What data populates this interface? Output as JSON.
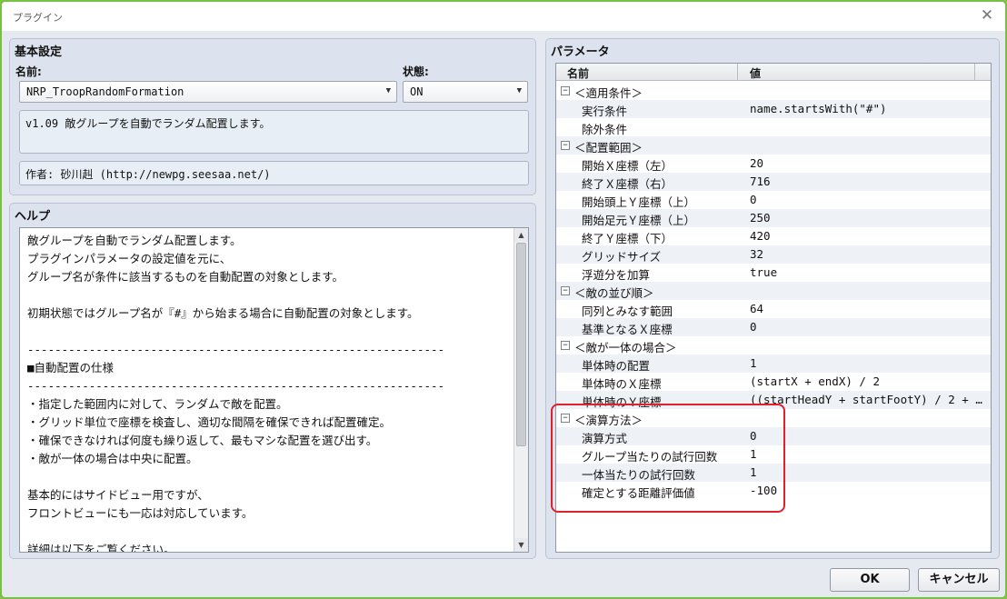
{
  "window": {
    "title": "プラグイン",
    "close_glyph": "✕"
  },
  "basic": {
    "group_title": "基本設定",
    "name_label": "名前:",
    "name_value": "NRP_TroopRandomFormation",
    "status_label": "状態:",
    "status_value": "ON",
    "description": "v1.09 敵グループを自動でランダム配置します。",
    "author": "作者: 砂川赳 (http://newpg.seesaa.net/)"
  },
  "help": {
    "group_title": "ヘルプ",
    "text": "敵グループを自動でランダム配置します。\nプラグインパラメータの設定値を元に、\nグループ名が条件に該当するものを自動配置の対象とします。\n\n初期状態ではグループ名が『#』から始まる場合に自動配置の対象とします。\n\n-------------------------------------------------------------\n■自動配置の仕様\n-------------------------------------------------------------\n・指定した範囲内に対して、ランダムで敵を配置。\n・グリッド単位で座標を検査し、適切な間隔を確保できれば配置確定。\n・確保できなければ何度も繰り返して、最もマシな配置を選び出す。\n・敵が一体の場合は中央に配置。\n\n基本的にはサイドビュー用ですが、\nフロントビューにも一応は対応しています。\n\n詳細は以下をご覧ください。"
  },
  "params": {
    "group_title": "パラメータ",
    "col_name": "名前",
    "col_value": "値",
    "rows": [
      {
        "name": "＜適用条件＞",
        "value": "",
        "group": true
      },
      {
        "name": "実行条件",
        "value": "name.startsWith(\"#\")",
        "group": false
      },
      {
        "name": "除外条件",
        "value": "",
        "group": false
      },
      {
        "name": "＜配置範囲＞",
        "value": "",
        "group": true
      },
      {
        "name": "開始Ｘ座標（左）",
        "value": "20",
        "group": false
      },
      {
        "name": "終了Ｘ座標（右）",
        "value": "716",
        "group": false
      },
      {
        "name": "開始頭上Ｙ座標（上）",
        "value": "0",
        "group": false
      },
      {
        "name": "開始足元Ｙ座標（上）",
        "value": "250",
        "group": false
      },
      {
        "name": "終了Ｙ座標（下）",
        "value": "420",
        "group": false
      },
      {
        "name": "グリッドサイズ",
        "value": "32",
        "group": false
      },
      {
        "name": "浮遊分を加算",
        "value": "true",
        "group": false
      },
      {
        "name": "＜敵の並び順＞",
        "value": "",
        "group": true
      },
      {
        "name": "同列とみなす範囲",
        "value": "64",
        "group": false
      },
      {
        "name": "基準となるＸ座標",
        "value": "0",
        "group": false
      },
      {
        "name": "＜敵が一体の場合＞",
        "value": "",
        "group": true
      },
      {
        "name": "単体時の配置",
        "value": "1",
        "group": false
      },
      {
        "name": "単体時のＸ座標",
        "value": "(startX + endX) / 2",
        "group": false
      },
      {
        "name": "単体時のＹ座標",
        "value": "((startHeadY + startFootY) / 2 + e…",
        "group": false
      },
      {
        "name": "＜演算方法＞",
        "value": "",
        "group": true
      },
      {
        "name": "演算方式",
        "value": "0",
        "group": false
      },
      {
        "name": "グループ当たりの試行回数",
        "value": "1",
        "group": false
      },
      {
        "name": "一体当たりの試行回数",
        "value": "1",
        "group": false
      },
      {
        "name": "確定とする距離評価値",
        "value": "-100",
        "group": false
      }
    ]
  },
  "buttons": {
    "ok": "OK",
    "cancel": "キャンセル"
  },
  "icons": {
    "expander": "minus-box-icon",
    "dropdown": "chevron-down-icon"
  },
  "colors": {
    "window_border": "#76c043",
    "highlight": "#e0202a",
    "group_bg": "#dce3ee"
  }
}
